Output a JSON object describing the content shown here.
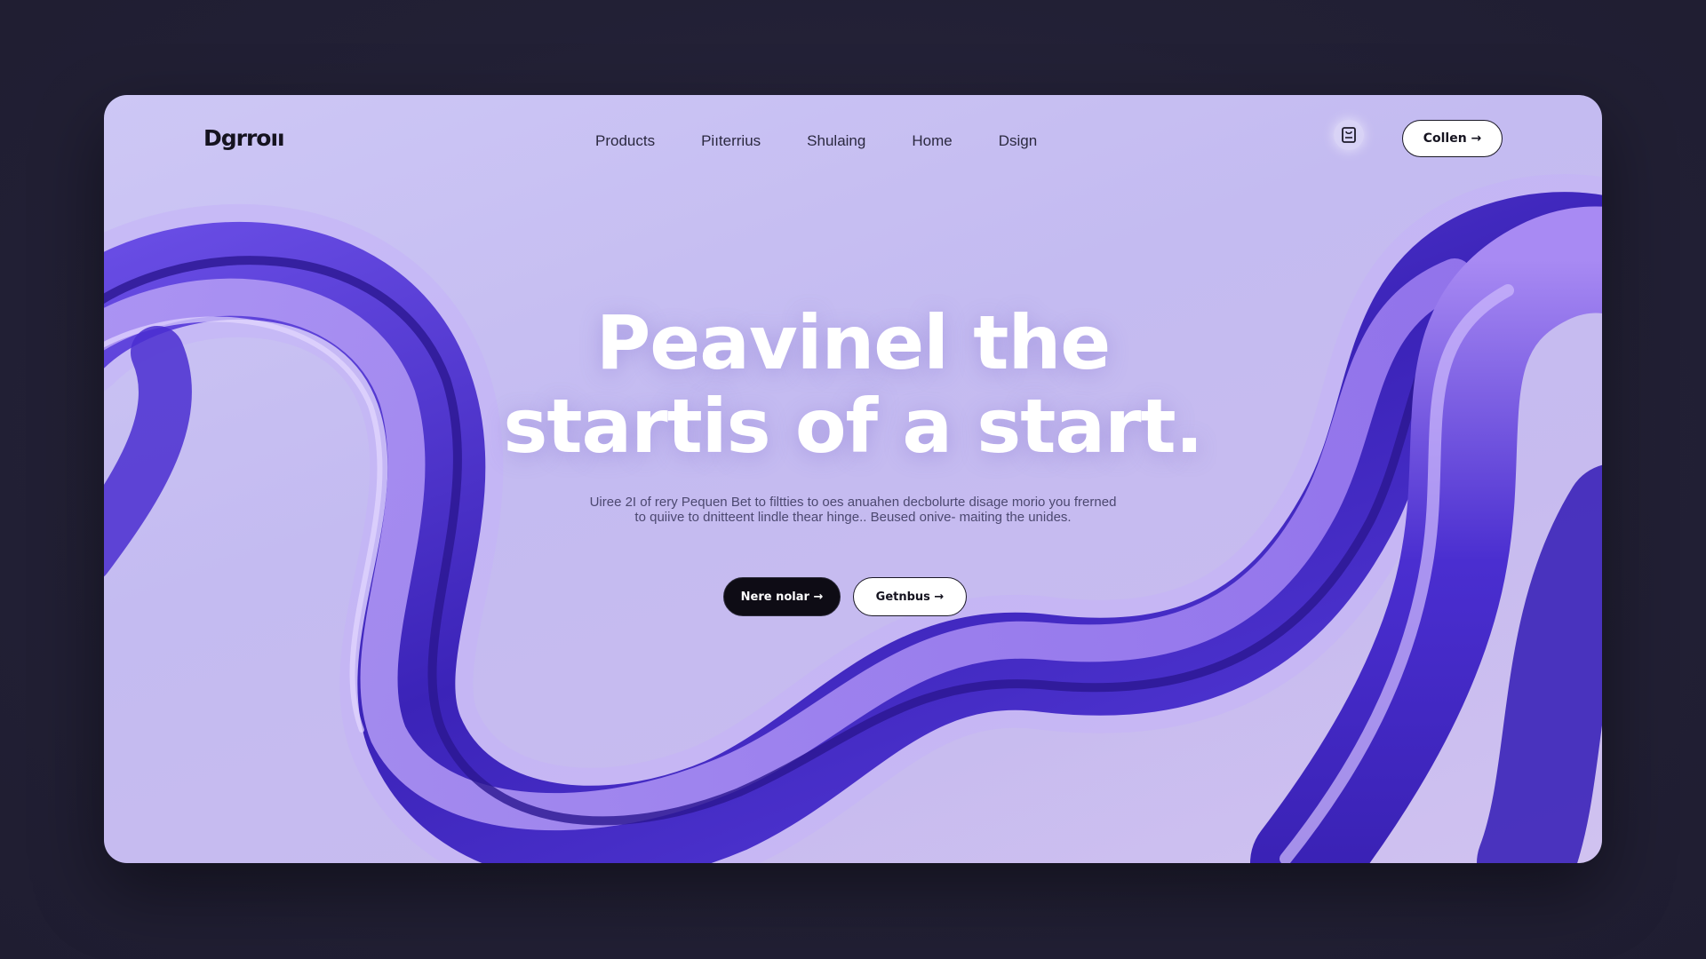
{
  "brand": {
    "logo": "Dgrroıı"
  },
  "nav": {
    "items": [
      {
        "label": "Products"
      },
      {
        "label": "Piıterrius"
      },
      {
        "label": "Shulaing"
      },
      {
        "label": "Home"
      },
      {
        "label": "Dsign"
      }
    ],
    "cart_icon": "bag-icon",
    "cta_label": "Collen →"
  },
  "hero": {
    "title_line1": "Peavinel the",
    "title_line2": "startis of a start.",
    "subtitle": "Uiree 2I of rery Pequen Bet to filtties to oes anuahen decbolurte disage morio you frerned to quiive to dnitteent lindle thear hinge.. Beused onive- maiting the unides.",
    "primary_button": "Nere nolar →",
    "secondary_button": "Getnbus →"
  },
  "colors": {
    "page_background": "#232136",
    "card_background": "#c8c0f2",
    "wave_dark": "#3b23b8",
    "wave_light": "#9b7cf0",
    "primary_button": "#0e0c15",
    "title_text": "#ffffff"
  }
}
